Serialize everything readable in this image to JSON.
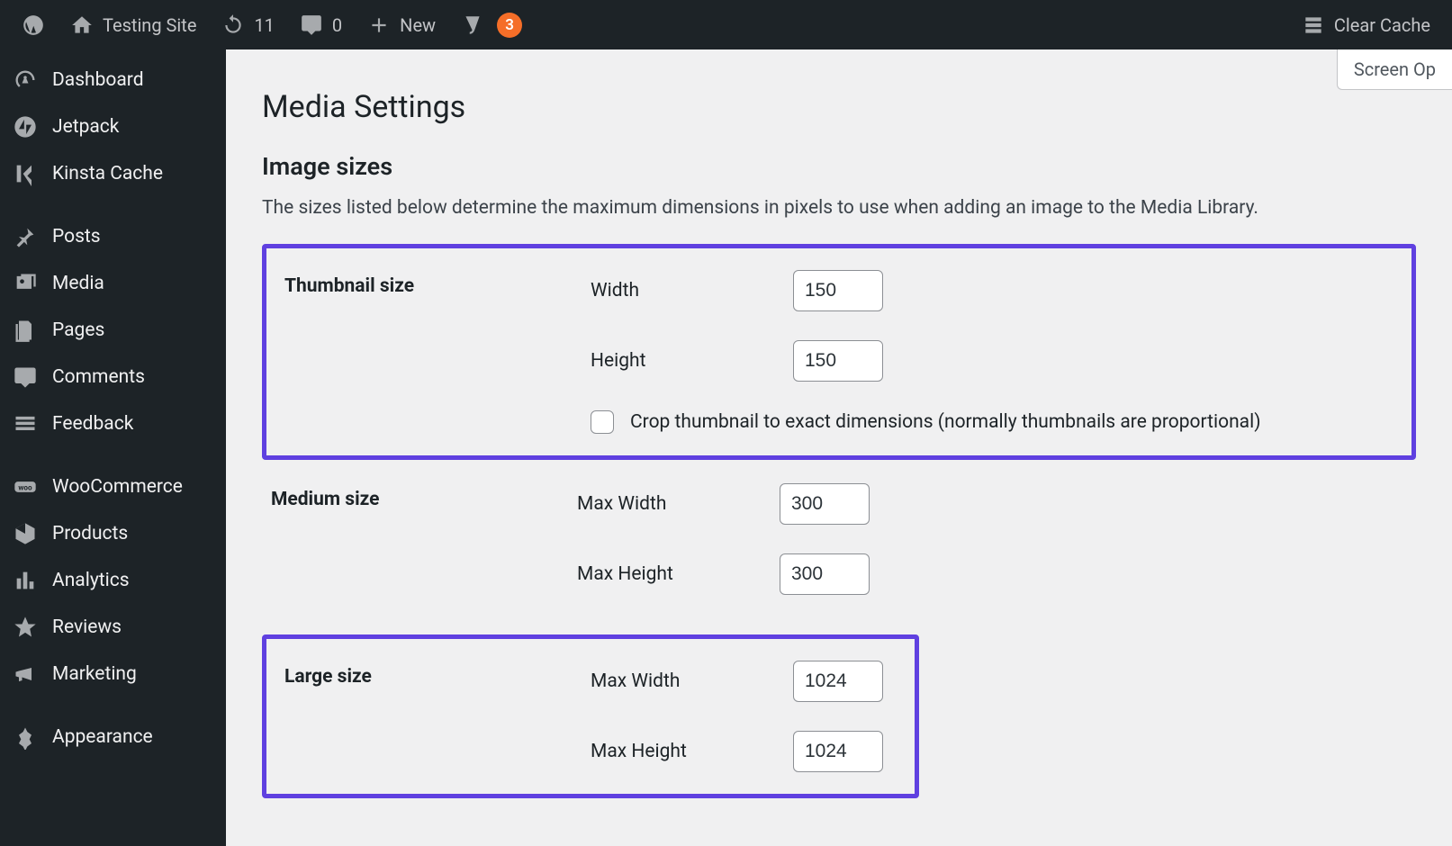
{
  "adminbar": {
    "site_name": "Testing Site",
    "updates_count": "11",
    "comments_count": "0",
    "new_label": "New",
    "seo_notifications": "3",
    "clear_cache": "Clear Cache"
  },
  "sidebar": {
    "items": [
      {
        "label": "Dashboard"
      },
      {
        "label": "Jetpack"
      },
      {
        "label": "Kinsta Cache"
      },
      {
        "label": "Posts"
      },
      {
        "label": "Media"
      },
      {
        "label": "Pages"
      },
      {
        "label": "Comments"
      },
      {
        "label": "Feedback"
      },
      {
        "label": "WooCommerce"
      },
      {
        "label": "Products"
      },
      {
        "label": "Analytics"
      },
      {
        "label": "Reviews"
      },
      {
        "label": "Marketing"
      },
      {
        "label": "Appearance"
      }
    ]
  },
  "main": {
    "screen_options": "Screen Op",
    "page_title": "Media Settings",
    "section_title": "Image sizes",
    "section_desc": "The sizes listed below determine the maximum dimensions in pixels to use when adding an image to the Media Library.",
    "thumbnail": {
      "heading": "Thumbnail size",
      "width_label": "Width",
      "width_value": "150",
      "height_label": "Height",
      "height_value": "150",
      "crop_label": "Crop thumbnail to exact dimensions (normally thumbnails are proportional)"
    },
    "medium": {
      "heading": "Medium size",
      "max_width_label": "Max Width",
      "max_width_value": "300",
      "max_height_label": "Max Height",
      "max_height_value": "300"
    },
    "large": {
      "heading": "Large size",
      "max_width_label": "Max Width",
      "max_width_value": "1024",
      "max_height_label": "Max Height",
      "max_height_value": "1024"
    }
  }
}
